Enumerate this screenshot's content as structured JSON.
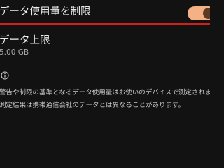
{
  "settings": {
    "data_limit_toggle": {
      "label": "データ使用量を制限",
      "checked": true,
      "color": "#f4b183"
    },
    "data_limit": {
      "title": "データ上限",
      "value": "5.00 GB"
    },
    "info": {
      "icon": "info-icon",
      "line1": "警告や制限の基準となるデータ使用量はお使いのデバイスで測定されます。",
      "line2": "測定結果は携帯通信会社のデータとは異なることがあります。"
    }
  },
  "colors": {
    "background": "#121212",
    "divider": "#d0201c",
    "accent": "#f4b183"
  }
}
